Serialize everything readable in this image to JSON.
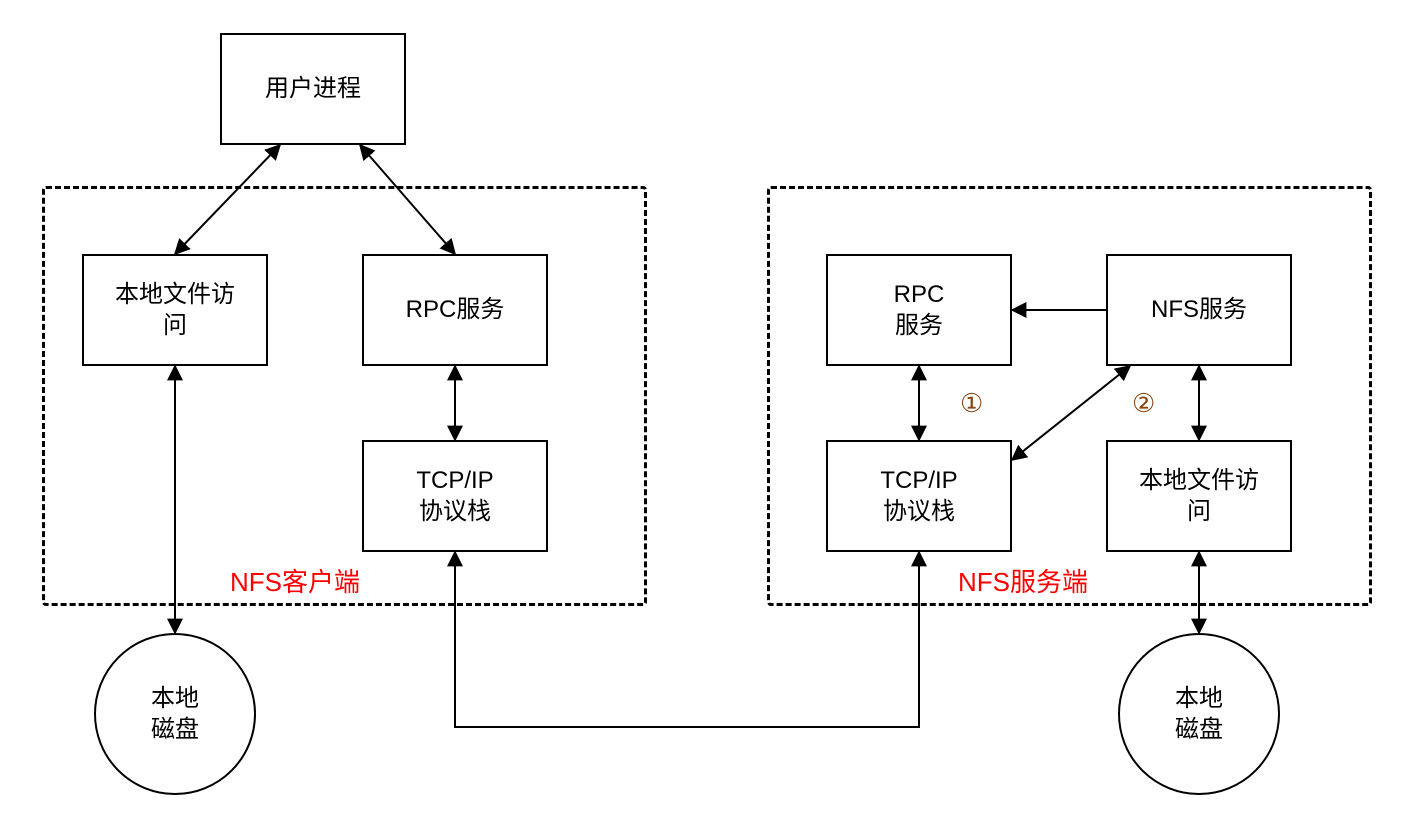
{
  "nodes": {
    "user_process": "用户进程",
    "local_file_access_client": "本地文件访\n问",
    "rpc_service_client": "RPC服务",
    "tcpip_stack_client": "TCP/IP\n协议栈",
    "local_disk_client": "本地\n磁盘",
    "rpc_service_server": "RPC\n服务",
    "nfs_service_server": "NFS服务",
    "tcpip_stack_server": "TCP/IP\n协议栈",
    "local_file_access_server": "本地文件访\n问",
    "local_disk_server": "本地\n磁盘"
  },
  "labels": {
    "nfs_client": "NFS客户端",
    "nfs_server": "NFS服务端"
  },
  "annotations": {
    "circled_1": "①",
    "circled_2": "②"
  }
}
